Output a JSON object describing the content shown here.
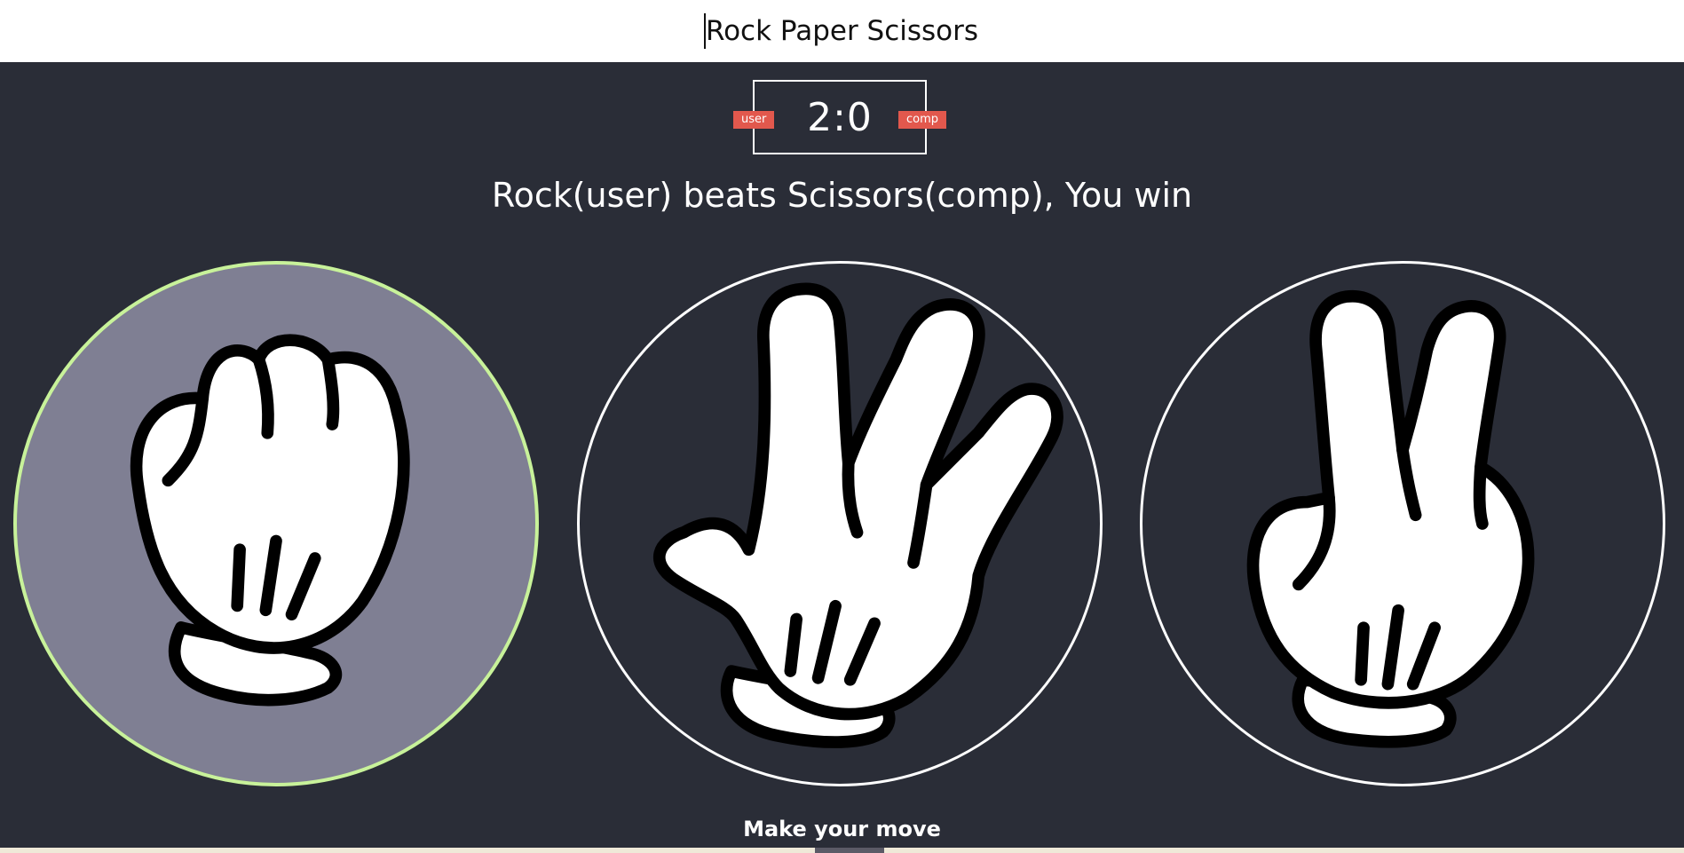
{
  "header": {
    "title": "Rock Paper Scissors"
  },
  "scoreboard": {
    "score": "2:0",
    "user_label": "user",
    "comp_label": "comp"
  },
  "result": {
    "message": "Rock(user) beats Scissors(comp), You win"
  },
  "choices": [
    {
      "name": "Rock",
      "icon": "rock-hand-icon",
      "selected": true
    },
    {
      "name": "Paper",
      "icon": "paper-hand-icon",
      "selected": false
    },
    {
      "name": "Scissors",
      "icon": "scissors-hand-icon",
      "selected": false
    }
  ],
  "footer": {
    "prompt": "Make your move"
  },
  "colors": {
    "background": "#2a2d37",
    "badge": "#e2584d",
    "selected_fill": "#7f7f93",
    "selected_ring": "#c8f29a"
  }
}
